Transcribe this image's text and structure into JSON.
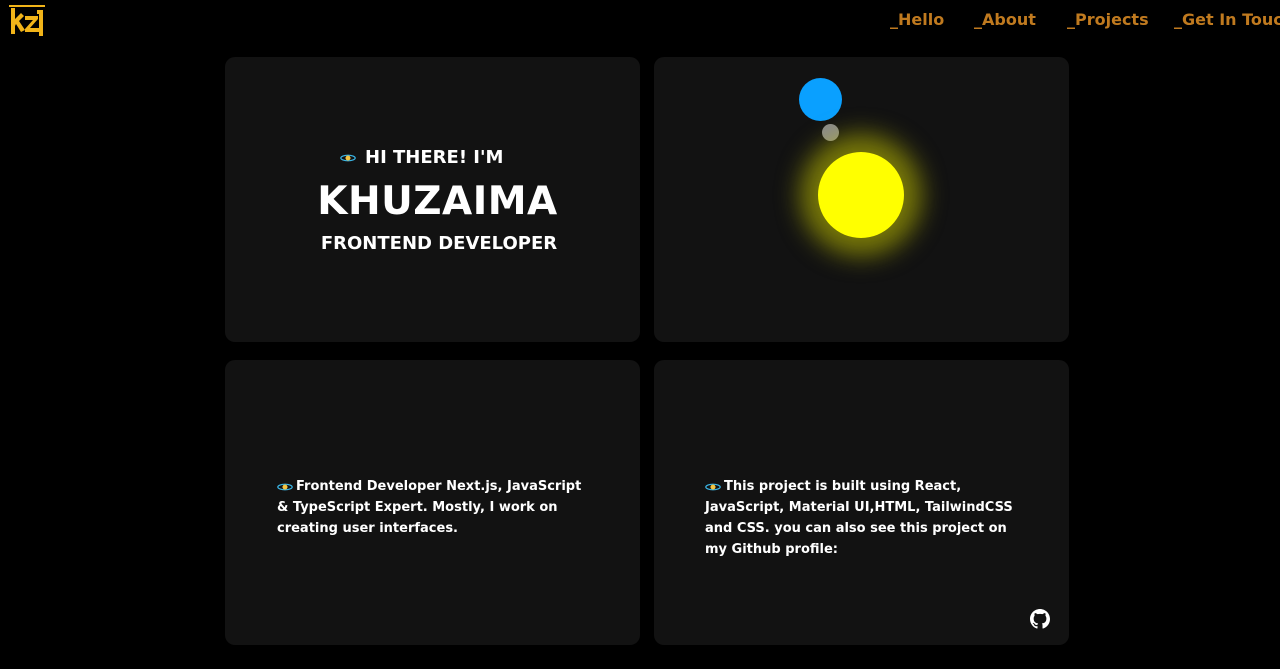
{
  "nav": {
    "items": [
      "_Hello",
      "_About",
      "_Projects",
      "_Get In Touch"
    ]
  },
  "hero": {
    "greeting": "HI THERE! I'M",
    "name": "KHUZAIMA",
    "role": "FRONTEND DEVELOPER"
  },
  "about": {
    "text": "Frontend Developer Next.js, JavaScript & TypeScript Expert. Mostly, I work on creating user interfaces."
  },
  "project": {
    "text": "This project is built using React, JavaScript, Material UI,HTML, TailwindCSS and CSS. you can also see this project on my Github profile:"
  },
  "icons": {
    "logo": "kz-logo",
    "sparkle": "ringed-planet-emoji",
    "github": "github-icon"
  },
  "colors": {
    "background": "#000000",
    "card": "#121212",
    "nav": "#c07a1f",
    "planet": "#0aa0ff",
    "moon": "#8a8a8a",
    "sun": "#ffff00"
  }
}
